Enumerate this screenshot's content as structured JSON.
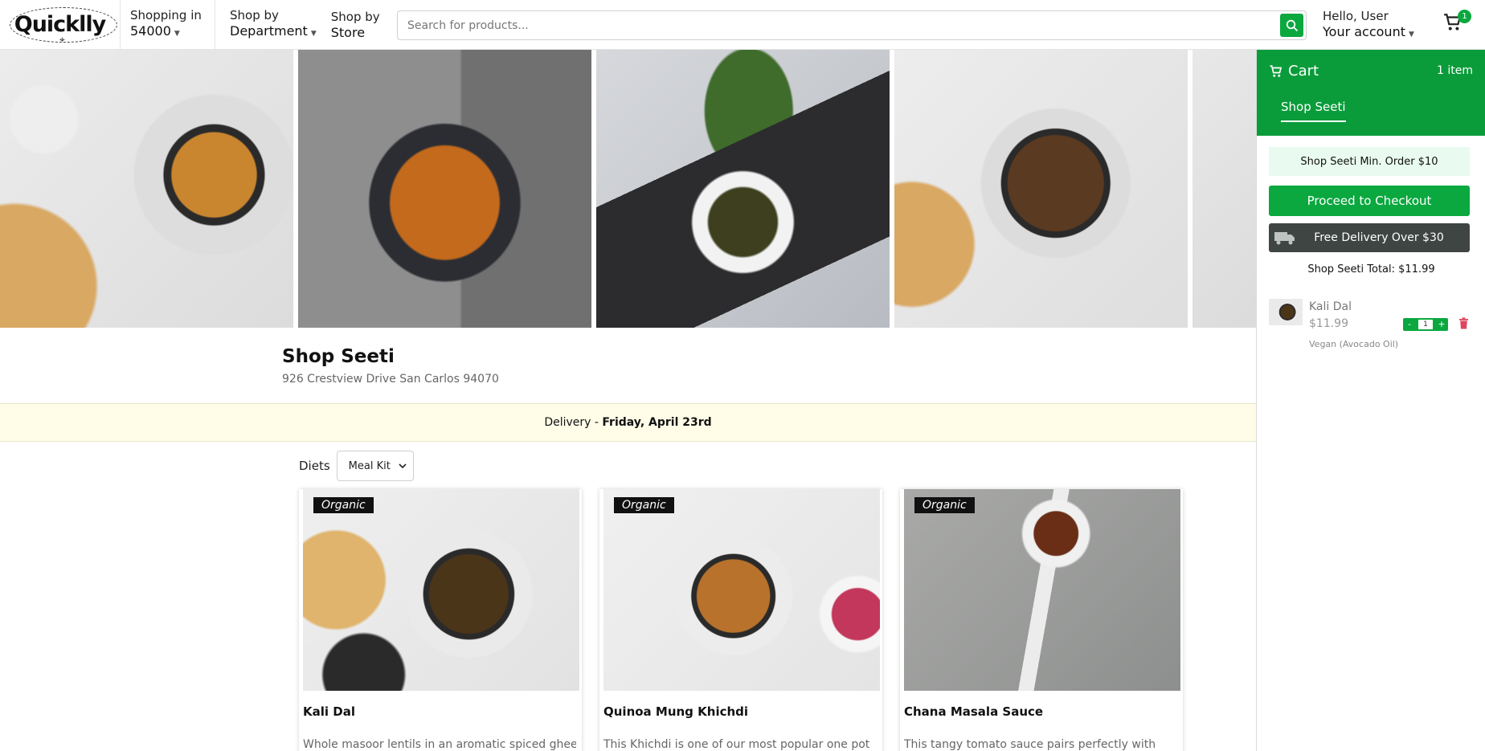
{
  "header": {
    "logo": "Quicklly",
    "shopping_in_label": "Shopping in",
    "zip": "54000",
    "shop_by_dept_top": "Shop by",
    "shop_by_dept_bottom": "Department",
    "shop_by_store_top": "Shop by",
    "shop_by_store_bottom": "Store",
    "search_placeholder": "Search for products...",
    "greeting": "Hello, User",
    "account_label": "Your account",
    "cart_badge": "1"
  },
  "shop": {
    "name": "Shop Seeti",
    "address": "926 Crestview Drive San Carlos 94070",
    "delivery_label": "Delivery - ",
    "delivery_date": "Friday, April 23rd"
  },
  "filters": {
    "diets_label": "Diets",
    "diets_selected": "Meal Kit"
  },
  "products": [
    {
      "tag": "Organic",
      "name": "Kali Dal",
      "desc": "Whole masoor lentils in an aromatic spiced ghee"
    },
    {
      "tag": "Organic",
      "name": "Quinoa Mung Khichdi",
      "desc": "This Khichdi is one of our most popular one pot"
    },
    {
      "tag": "Organic",
      "name": "Chana Masala Sauce",
      "desc": "This tangy tomato sauce pairs perfectly with"
    }
  ],
  "cart": {
    "title": "Cart",
    "count_text": "1 item",
    "tab": "Shop Seeti",
    "min_order": "Shop Seeti Min. Order $10",
    "checkout": "Proceed to Checkout",
    "free_delivery": "Free Delivery Over $30",
    "total": "Shop Seeti Total: $11.99",
    "item": {
      "name": "Kali Dal",
      "price": "$11.99",
      "option": "Vegan (Avocado Oil)",
      "qty": "1",
      "minus": "-",
      "plus": "+"
    }
  },
  "colors": {
    "brand_green": "#0aa83f",
    "cart_header_green": "#0a9c3a",
    "delivery_bar_bg": "#fffde8",
    "dark_banner": "#3f4543"
  }
}
